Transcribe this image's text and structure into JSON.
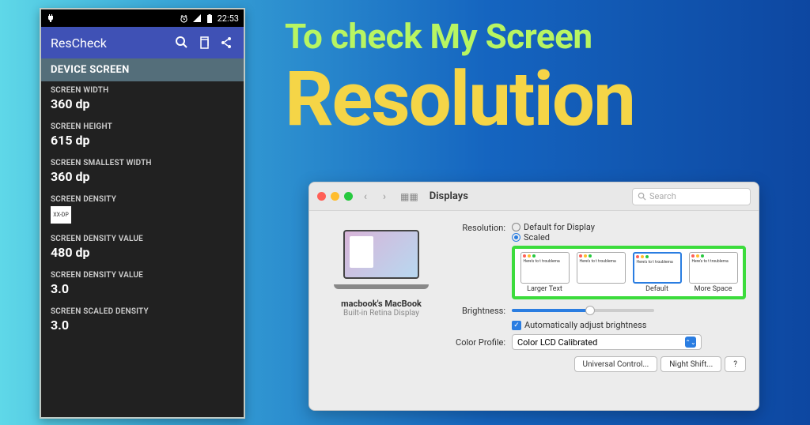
{
  "headline": {
    "line1": "To check My Screen",
    "line2": "Resolution"
  },
  "android": {
    "status": {
      "time": "22:53"
    },
    "app_title": "ResCheck",
    "section_header": "DEVICE SCREEN",
    "density_box": "XX-DP",
    "metrics": [
      {
        "label": "SCREEN WIDTH",
        "value": "360 dp"
      },
      {
        "label": "SCREEN HEIGHT",
        "value": "615 dp"
      },
      {
        "label": "SCREEN SMALLEST WIDTH",
        "value": "360 dp"
      },
      {
        "label": "SCREEN DENSITY",
        "value": ""
      },
      {
        "label": "SCREEN DENSITY VALUE",
        "value": "480 dp"
      },
      {
        "label": "SCREEN DENSITY VALUE",
        "value": "3.0"
      },
      {
        "label": "SCREEN SCALED DENSITY",
        "value": "3.0"
      }
    ]
  },
  "mac": {
    "title": "Displays",
    "search_placeholder": "Search",
    "device_name": "macbook's MacBook",
    "device_sub": "Built-in Retina Display",
    "labels": {
      "resolution": "Resolution:",
      "brightness": "Brightness:",
      "color_profile": "Color Profile:"
    },
    "options": {
      "default_for_display": "Default for Display",
      "scaled": "Scaled"
    },
    "scale_options": [
      "Larger Text",
      "",
      "Default",
      "More Space"
    ],
    "thumb_text": "Here's to t\ntroublema",
    "auto_brightness": "Automatically adjust brightness",
    "color_profile_value": "Color LCD Calibrated",
    "buttons": {
      "universal": "Universal Control...",
      "night_shift": "Night Shift...",
      "help": "?"
    }
  }
}
